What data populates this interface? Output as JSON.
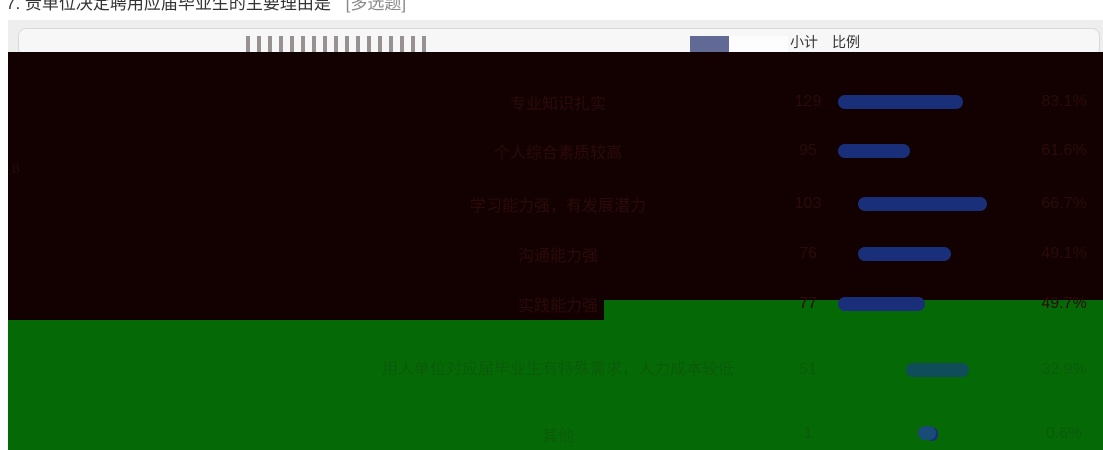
{
  "question": {
    "title": "7. 贵单位决定聘用应届毕业生的主要理由是",
    "tag": "[多选题]"
  },
  "table": {
    "columns": [
      "",
      "小计",
      "比例"
    ],
    "rows": [
      {
        "label": "专业知识扎实",
        "count": "129",
        "percent": "83.1%",
        "bar": 0.83
      },
      {
        "label": "个人综合素质较高",
        "count": "95",
        "percent": "61.6%",
        "bar": 0.48
      },
      {
        "label": "学习能力强，有发展潜力",
        "count": "103",
        "percent": "66.7%",
        "bar": 0.86
      },
      {
        "label": "沟通能力强",
        "count": "76",
        "percent": "49.1%",
        "bar": 0.62
      },
      {
        "label": "实践能力强",
        "count": "77",
        "percent": "49.7%",
        "bar": 0.58
      },
      {
        "label": "用人单位对应届毕业生有特殊需求，人力成本较低",
        "count": "51",
        "percent": "32.9%",
        "bar": 0.42
      },
      {
        "label": "其他",
        "count": "1",
        "percent": "0.6%",
        "bar": 0.08
      }
    ]
  },
  "colors": {
    "dark_band": "#130000",
    "green_band": "#056a05",
    "bar_fill": "#1a2f7a"
  }
}
